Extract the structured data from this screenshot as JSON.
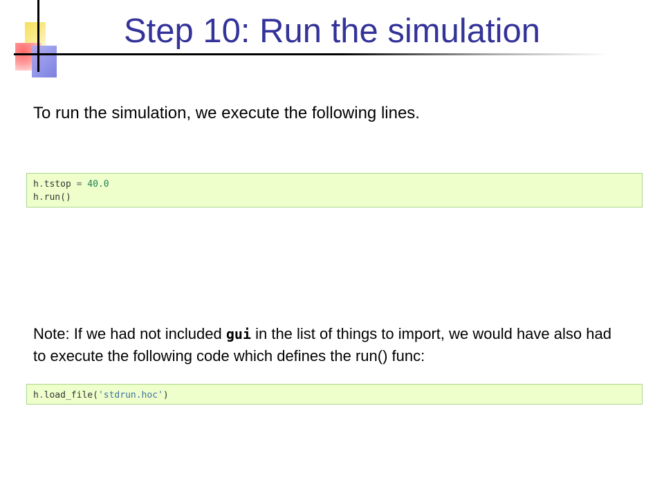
{
  "slide": {
    "title": "Step 10: Run the simulation",
    "intro": "To run the simulation, we execute the following lines.",
    "code_block_1": {
      "line_1": {
        "obj": "h",
        "dot": ".",
        "attr": "tstop",
        "op": " = ",
        "value": "40.0"
      },
      "line_2": {
        "obj": "h",
        "dot": ".",
        "attr": "run",
        "parens": "()"
      }
    },
    "note": {
      "before": "Note: If we had not included ",
      "keyword": "gui",
      "after": " in the list of things to import, we would have also had to execute the following code which defines the run() func:"
    },
    "code_block_2": {
      "line_1": {
        "obj": "h",
        "dot": ".",
        "func": "load_file",
        "open": "(",
        "arg": "'stdrun.hoc'",
        "close": ")"
      }
    }
  },
  "colors": {
    "title": "#333399",
    "code_bg": "#eeffcc",
    "code_border": "#a9d68c",
    "number": "#208050",
    "string": "#4070a0",
    "logo_yellow": "#f6e05a",
    "logo_red": "#ff6b6b",
    "logo_blue": "#8a8de8"
  },
  "icons": {
    "logo": "slide-logo-squares-icon"
  }
}
